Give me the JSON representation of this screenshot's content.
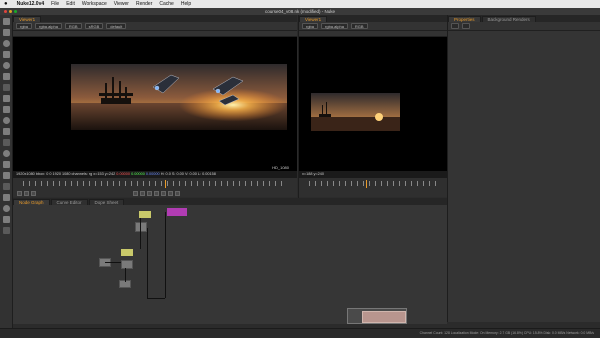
{
  "menubar": {
    "app": "Nuke12.0v4",
    "items": [
      "File",
      "Edit",
      "Workspace",
      "Viewer",
      "Render",
      "Cache",
      "Help"
    ]
  },
  "window": {
    "title": "course04_v08.nk (modified) - Nuke"
  },
  "viewer1": {
    "tab": "Viewer1",
    "controls": [
      "rgba",
      "rgba.alpha",
      "RGB",
      "sRGB",
      "default"
    ],
    "info": {
      "prefix": "1920x1080  bbox: 0 0 1920 1080 channels: rg  x=153 y=242",
      "r": "0.00000",
      "g": "0.00000",
      "b": "0.00000",
      "suffix": "H: 0.0 S: 0.00 V: 0.00  L: 0.00158"
    },
    "format_label": "HD_1080"
  },
  "viewer2": {
    "tab": "Viewer1",
    "controls": [
      "rgba",
      "rgba.alpha",
      "RGB"
    ],
    "info": "x=188 y=240",
    "format_label": "HD"
  },
  "right_tabs": [
    "Properties",
    "Background Renders"
  ],
  "node_tabs": [
    "Node Graph",
    "Curve Editor",
    "Dope Sheet"
  ],
  "status": "Channel Count: 128  Localization Mode: On  Memory: 2.7 GB (16.8%)  CPU: 15.8%  Disk: 0.0 MB/s  Network: 0.0 MB/s"
}
